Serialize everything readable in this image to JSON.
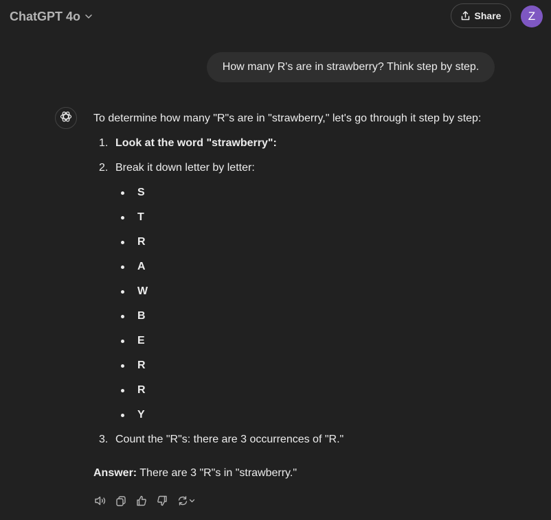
{
  "header": {
    "model_name": "ChatGPT 4o",
    "share_label": "Share",
    "avatar_initial": "Z"
  },
  "conversation": {
    "user_message": "How many R's are in strawberry? Think step by step.",
    "assistant": {
      "intro": "To determine how many \"R\"s are in \"strawberry,\" let's go through it step by step:",
      "steps": [
        {
          "number": "1.",
          "text": "Look at the word \"strawberry\":"
        },
        {
          "number": "2.",
          "text": "Break it down letter by letter:"
        },
        {
          "number": "3.",
          "text": "Count the \"R\"s: there are 3 occurrences of \"R.\""
        }
      ],
      "letters": [
        "S",
        "T",
        "R",
        "A",
        "W",
        "B",
        "E",
        "R",
        "R",
        "Y"
      ],
      "answer_label": "Answer:",
      "answer_text": " There are 3 \"R\"s in \"strawberry.\""
    },
    "action_icons": [
      "speaker-icon",
      "copy-icon",
      "thumbs-up-icon",
      "thumbs-down-icon",
      "regenerate-icon"
    ]
  },
  "colors": {
    "background": "#212121",
    "user_bubble": "#2f2f2f",
    "text": "#ececec",
    "muted_text": "#b4b4b4",
    "avatar": "#7e57c2"
  }
}
